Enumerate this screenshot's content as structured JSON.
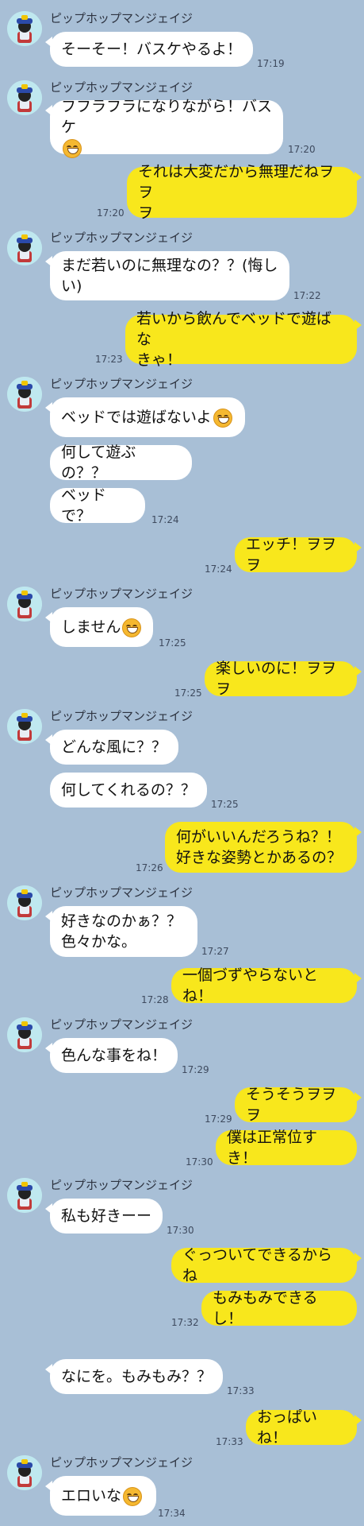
{
  "sender_name": "ピップホップマンジェイジ",
  "colors": {
    "background": "#a8bfd6",
    "sent_bubble": "#f8e71c",
    "received_bubble": "#ffffff"
  },
  "messages": [
    {
      "side": "recv",
      "text": "そーそー！バスケやるよ！",
      "time": "17:19"
    },
    {
      "side": "recv",
      "text": "フフラフラになりながら！バスケ",
      "time": "17:20"
    },
    {
      "side": "sent",
      "lines": [
        "それは大変だから無理だねヲヲ",
        "ヲ"
      ],
      "time": "17:20"
    },
    {
      "side": "recv",
      "lines": [
        "まだ若いのに無理なの？？(悔し",
        "い)"
      ],
      "time": "17:22"
    },
    {
      "side": "sent",
      "lines": [
        "若いから飲んでベッドで遊ばな",
        "きゃ！"
      ],
      "time": "17:23"
    },
    {
      "side": "recv",
      "text": "ベッドでは遊ばないよ"
    },
    {
      "side": "recv",
      "text": "何して遊ぶの？？"
    },
    {
      "side": "recv",
      "text": "ベッドで？",
      "time": "17:24"
    },
    {
      "side": "sent",
      "text": "エッチ！ヲヲヲ",
      "time": "17:24"
    },
    {
      "side": "recv",
      "text": "しません",
      "time": "17:25"
    },
    {
      "side": "sent",
      "text": "楽しいのに！ヲヲヲ",
      "time": "17:25"
    },
    {
      "side": "recv",
      "text": "どんな風に？？"
    },
    {
      "side": "recv",
      "text": "何してくれるの？？",
      "time": "17:25"
    },
    {
      "side": "sent",
      "lines": [
        "何がいいんだろうね？！",
        "好きな姿勢とかあるの？"
      ],
      "time": "17:26"
    },
    {
      "side": "recv",
      "lines": [
        "好きなのかぁ？？",
        "色々かな。"
      ],
      "time": "17:27"
    },
    {
      "side": "sent",
      "text": "一個づずやらないとね！",
      "time": "17:28"
    },
    {
      "side": "recv",
      "text": "色んな事をね！",
      "time": "17:29"
    },
    {
      "side": "sent",
      "text": "そうそうヲヲヲ",
      "time": "17:29"
    },
    {
      "side": "sent",
      "text": "僕は正常位すき！",
      "time": "17:30"
    },
    {
      "side": "recv",
      "text": "私も好きーー",
      "time": "17:30"
    },
    {
      "side": "sent",
      "text": "ぐっついてできるからね"
    },
    {
      "side": "sent",
      "text": "もみもみできるし！",
      "time": "17:32"
    },
    {
      "side": "recv",
      "text": "なにを。もみもみ？？",
      "time": "17:33"
    },
    {
      "side": "sent",
      "text": "おっぱいね！",
      "time": "17:33"
    },
    {
      "side": "recv",
      "text": "エロいな",
      "time": "17:34"
    }
  ]
}
